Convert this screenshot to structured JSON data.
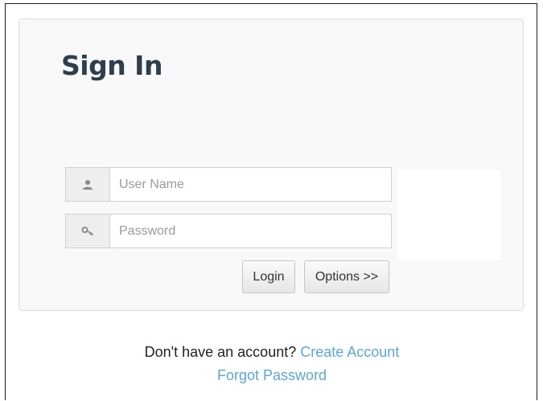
{
  "title": "Sign In",
  "username": {
    "placeholder": "User Name",
    "value": "",
    "icon": "user-icon"
  },
  "password": {
    "placeholder": "Password",
    "value": "",
    "icon": "key-icon"
  },
  "buttons": {
    "login": "Login",
    "options": "Options >>"
  },
  "footer": {
    "prompt": "Don't have an account?",
    "create_link": "Create Account",
    "forgot_link": "Forgot Password"
  },
  "colors": {
    "title": "#2d3e4c",
    "link": "#5aa7d8",
    "panel_bg": "#f8f8f8"
  }
}
